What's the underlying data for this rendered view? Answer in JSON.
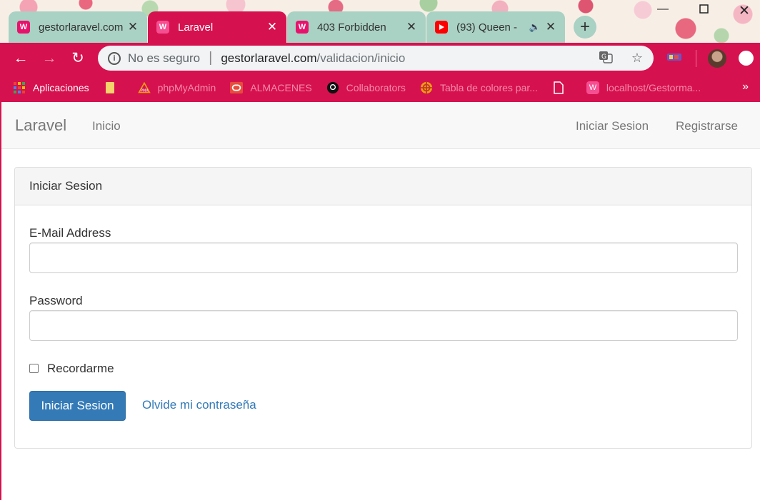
{
  "browser": {
    "tabs": [
      {
        "title": "gestorlaravel.com",
        "favicon": "wamp-icon",
        "active": false
      },
      {
        "title": "Laravel",
        "favicon": "wamp-icon",
        "active": true
      },
      {
        "title": "403 Forbidden",
        "favicon": "wamp-icon",
        "active": false
      },
      {
        "title": "(93) Queen -",
        "favicon": "youtube-icon",
        "active": false
      }
    ],
    "new_tab_symbol": "+",
    "close_symbol": "✕",
    "address": {
      "security_label": "No es seguro",
      "host": "gestorlaravel.com",
      "path": "/validacion/inicio"
    },
    "bookmarks": [
      {
        "label": "Aplicaciones",
        "icon": "apps-grid-icon"
      },
      {
        "label": "",
        "icon": "folder-icon"
      },
      {
        "label": "phpMyAdmin",
        "icon": "phpmyadmin-icon"
      },
      {
        "label": "ALMACENES",
        "icon": "oracle-icon"
      },
      {
        "label": "Collaborators",
        "icon": "github-icon"
      },
      {
        "label": "Tabla de colores par...",
        "icon": "palette-icon"
      },
      {
        "label": "",
        "icon": "document-icon"
      },
      {
        "label": "localhost/Gestorma...",
        "icon": "wamp-icon"
      }
    ],
    "bookmarks_more": "»",
    "colors": {
      "accent": "#d6114f",
      "inactive_tab": "#a9d1c4"
    }
  },
  "navbar": {
    "brand": "Laravel",
    "home": "Inicio",
    "login": "Iniciar Sesion",
    "register": "Registrarse"
  },
  "login_panel": {
    "heading": "Iniciar Sesion",
    "email_label": "E-Mail Address",
    "email_value": "",
    "password_label": "Password",
    "password_value": "",
    "remember_label": "Recordarme",
    "remember_checked": false,
    "submit_label": "Iniciar Sesion",
    "forgot_label": "Olvide mi contraseña",
    "colors": {
      "primary": "#337ab7"
    }
  }
}
